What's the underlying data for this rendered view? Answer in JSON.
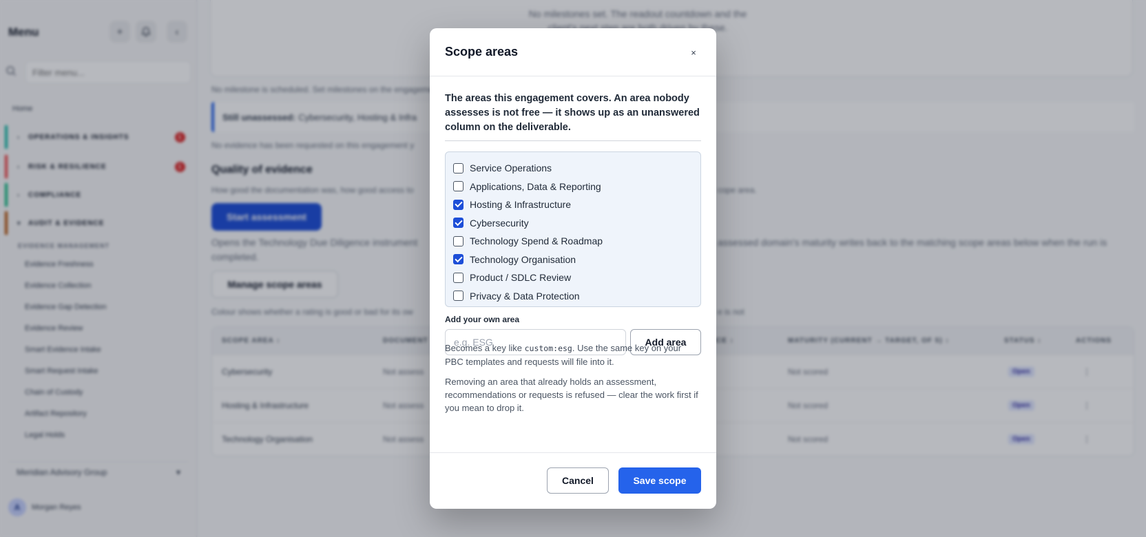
{
  "sidebar": {
    "title": "Menu",
    "filter_placeholder": "Filter menu...",
    "home": "Home",
    "groups": [
      {
        "label": "OPERATIONS & INSIGHTS",
        "badge": "1",
        "color": "#14b8a6"
      },
      {
        "label": "RISK & RESILIENCE",
        "badge": "1",
        "color": "#ef4444"
      },
      {
        "label": "COMPLIANCE",
        "badge": "",
        "color": "#10b981"
      },
      {
        "label": "AUDIT & EVIDENCE",
        "badge": "",
        "color": "#b45309"
      }
    ],
    "sub_title": "EVIDENCE MANAGEMENT",
    "items": [
      "Evidence Freshness",
      "Evidence Collection",
      "Evidence Gap Detection",
      "Evidence Review",
      "Smart Evidence Intake",
      "Smart Request Intake",
      "Chain of Custody",
      "Artifact Repository",
      "Legal Holds"
    ],
    "org": "Meridian Advisory Group",
    "user_initial": "A",
    "user_name": "Morgan Reyes"
  },
  "main": {
    "top_msg": "No milestones set. The readout countdown and the client's next step are both driven by these.",
    "no_milestone": "No milestone is scheduled. Set milestones on the engagement",
    "callout_bold": "Still unassessed:",
    "callout_text": "Cybersecurity, Hosting & Infra",
    "no_evidence": "No evidence has been requested on this engagement y",
    "quality_heading": "Quality of evidence",
    "quality_desc": "How good the documentation was, how good access to",
    "quality_desc_end": "cope area.",
    "start_btn": "Start assessment",
    "opens_text": "Opens the Technology Due Diligence instrument",
    "opens_text_end": "assessed domain's maturity writes back to the matching scope areas below when the run is",
    "completed": "completed.",
    "manage_btn": "Manage scope areas",
    "colour_text": "Colour shows whether a rating is good or bad for its ow",
    "colour_end": "e is not",
    "columns": [
      "SCOPE AREA",
      "DOCUMENT",
      "ENCE",
      "MATURITY (CURRENT → TARGET, OF 5)",
      "STATUS",
      "ACTIONS"
    ],
    "rows": [
      {
        "area": "Cybersecurity",
        "doc": "Not assess",
        "maturity": "Not scored",
        "status": "Open"
      },
      {
        "area": "Hosting & Infrastructure",
        "doc": "Not assess",
        "maturity": "Not scored",
        "status": "Open"
      },
      {
        "area": "Technology Organisation",
        "doc": "Not assess",
        "maturity": "Not scored",
        "status": "Open"
      }
    ]
  },
  "modal": {
    "title": "Scope areas",
    "close": "×",
    "intro": "The areas this engagement covers. An area nobody assesses is not free — it shows up as an unanswered column on the deliverable.",
    "areas": [
      {
        "label": "Service Operations",
        "checked": false
      },
      {
        "label": "Applications, Data & Reporting",
        "checked": false
      },
      {
        "label": "Hosting & Infrastructure",
        "checked": true
      },
      {
        "label": "Cybersecurity",
        "checked": true
      },
      {
        "label": "Technology Spend & Roadmap",
        "checked": false
      },
      {
        "label": "Technology Organisation",
        "checked": true
      },
      {
        "label": "Product / SDLC Review",
        "checked": false
      },
      {
        "label": "Privacy & Data Protection",
        "checked": false
      }
    ],
    "own_label": "Add your own area",
    "own_placeholder": "e.g. ESG",
    "add_btn": "Add area",
    "note1_a": "Becomes a key like ",
    "note1_code": "custom:esg",
    "note1_b": ". Use the same key on your PBC templates and requests will file into it.",
    "note2": "Removing an area that already holds an assessment, recommendations or requests is refused — clear the work first if you mean to drop it.",
    "cancel_btn": "Cancel",
    "save_btn": "Save scope"
  },
  "icons": {
    "plus": "+",
    "bell": "🔔",
    "collapse": "‹",
    "search": "⌕",
    "chevron_right": "›",
    "chevron_down": "▾",
    "sort": "↕",
    "more": "⋮"
  }
}
